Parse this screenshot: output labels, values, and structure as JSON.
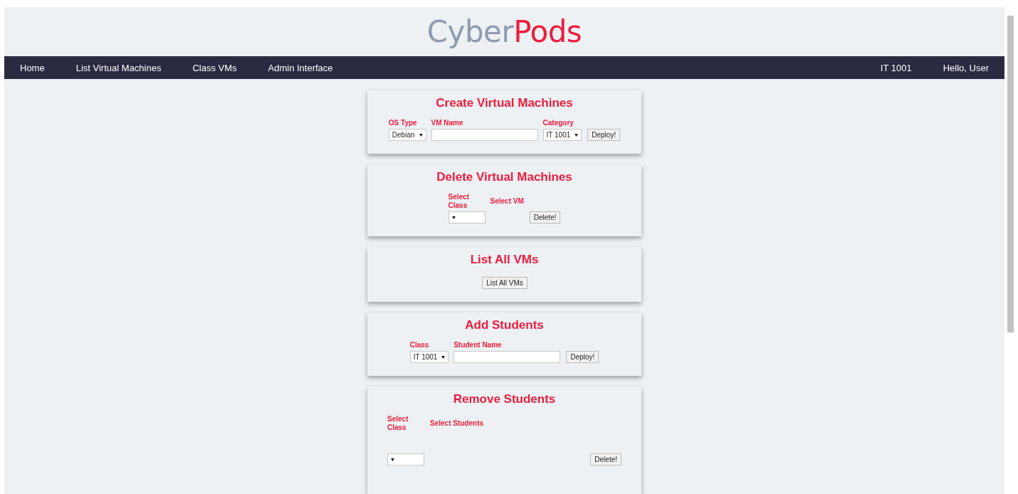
{
  "logo": [
    {
      "text": "Cyber",
      "kind": "muted"
    },
    {
      "text": "Pods",
      "kind": "accent"
    }
  ],
  "nav": {
    "left": [
      "Home",
      "List Virtual Machines",
      "Class VMs",
      "Admin Interface"
    ],
    "right": [
      "IT 1001",
      "Hello, User"
    ]
  },
  "panels": [
    {
      "title": "Create Virtual Machines",
      "kind": "compact",
      "fields": [
        {
          "kind": "select",
          "label": "OS Type",
          "value": "Debian"
        },
        {
          "kind": "text",
          "label": "VM Name"
        },
        {
          "kind": "select",
          "label": "Category",
          "value": "IT 1001"
        }
      ],
      "button": "Deploy!"
    },
    {
      "title": "Delete Virtual Machines",
      "kind": "compact",
      "fields": [
        {
          "kind": "select",
          "label": "Select Class"
        },
        {
          "kind": "label",
          "label": "Select VM"
        }
      ],
      "button": "Delete!"
    },
    {
      "title": "List All VMs",
      "kind": "compact",
      "button": "List All VMs"
    },
    {
      "title": "Add Students",
      "kind": "compact",
      "fields": [
        {
          "kind": "select",
          "label": "Class",
          "value": "IT 1001"
        },
        {
          "kind": "text",
          "label": "Student Name"
        }
      ],
      "button": "Deploy!"
    },
    {
      "title": "Remove Students",
      "kind": "wide",
      "fields": [
        {
          "kind": "select",
          "label": "Select Class"
        },
        {
          "kind": "label",
          "label": "Select Students"
        }
      ],
      "button": "Delete!"
    }
  ]
}
